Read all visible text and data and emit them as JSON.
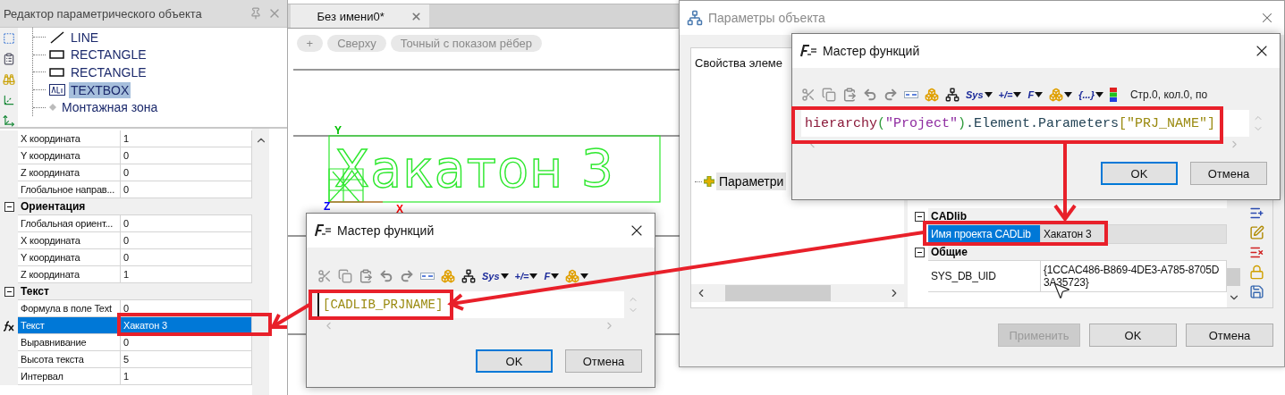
{
  "left_panel": {
    "title": "Редактор параметрического объекта",
    "tree": [
      {
        "label": "LINE",
        "kind": "line",
        "selected": false
      },
      {
        "label": "RECTANGLE",
        "kind": "rectangle",
        "selected": false
      },
      {
        "label": "RECTANGLE",
        "kind": "rectangle",
        "selected": false
      },
      {
        "label": "TEXTBOX",
        "kind": "textbox",
        "selected": true
      },
      {
        "label": "Монтажная зона",
        "kind": "zone",
        "selected": false
      }
    ],
    "properties": [
      {
        "kind": "row",
        "label": "X координата",
        "value": "1",
        "selected": false,
        "formula": false
      },
      {
        "kind": "row",
        "label": "Y координата",
        "value": "0",
        "selected": false,
        "formula": false
      },
      {
        "kind": "row",
        "label": "Z координата",
        "value": "0",
        "selected": false,
        "formula": false
      },
      {
        "kind": "row",
        "label": "Глобальное направ...",
        "value": "0",
        "selected": false,
        "formula": false
      },
      {
        "kind": "group",
        "label": "Ориентация",
        "expanded": true
      },
      {
        "kind": "row",
        "label": "Глобальная ориент...",
        "value": "0",
        "selected": false,
        "formula": false
      },
      {
        "kind": "row",
        "label": "X координата",
        "value": "0",
        "selected": false,
        "formula": false
      },
      {
        "kind": "row",
        "label": "Y координата",
        "value": "0",
        "selected": false,
        "formula": false
      },
      {
        "kind": "row",
        "label": "Z координата",
        "value": "1",
        "selected": false,
        "formula": false
      },
      {
        "kind": "group",
        "label": "Текст",
        "expanded": true
      },
      {
        "kind": "row",
        "label": "Формула в поле Text",
        "value": "0",
        "selected": false,
        "formula": false
      },
      {
        "kind": "row",
        "label": "Текст",
        "value": "Хакатон 3",
        "selected": true,
        "formula": true
      },
      {
        "kind": "row",
        "label": "Выравнивание",
        "value": "0",
        "selected": false,
        "formula": false
      },
      {
        "kind": "row",
        "label": "Высота текста",
        "value": "5",
        "selected": false,
        "formula": false
      },
      {
        "kind": "row",
        "label": "Интервал",
        "value": "1",
        "selected": false,
        "formula": false
      }
    ]
  },
  "document": {
    "tab": "Без имени0*",
    "view_buttons": [
      "+",
      "Сверху",
      "Точный с показом рёбер"
    ],
    "drawing_text": "Хакатон 3",
    "axis_labels": [
      {
        "label": "Y",
        "color": "#00c000"
      },
      {
        "label": "Z",
        "color": "#0000ff"
      },
      {
        "label": "X",
        "color": "#ff0000"
      }
    ]
  },
  "wizard_left": {
    "title": "Мастер функций",
    "toolbar": [
      {
        "kind": "cut"
      },
      {
        "kind": "copy"
      },
      {
        "kind": "paste"
      },
      {
        "kind": "undo"
      },
      {
        "kind": "redo"
      },
      {
        "kind": "field"
      },
      {
        "kind": "cubes",
        "dropdown": false
      },
      {
        "kind": "tree"
      },
      {
        "kind": "text",
        "label": "Sys",
        "dropdown": true
      },
      {
        "kind": "text",
        "label": "+/=",
        "dropdown": true
      },
      {
        "kind": "text",
        "label": "F",
        "dropdown": true
      },
      {
        "kind": "cubes",
        "dropdown": true
      }
    ],
    "formula": [
      {
        "text": "[CADLIB_PRJNAME]",
        "kind": "parameter"
      }
    ],
    "buttons": [
      {
        "label": "OK",
        "default": true
      },
      {
        "label": "Отмена",
        "default": false
      }
    ]
  },
  "object_parameters": {
    "title": "Параметры объекта",
    "tree_header": "Свойства элеме",
    "tree": [
      {
        "label": "Параметри",
        "selected": true
      }
    ],
    "properties": [
      {
        "kind": "group",
        "label": "CADlib",
        "expanded": true
      },
      {
        "kind": "row",
        "label": "Имя проекта CADLib",
        "value": "Хакатон 3",
        "selected": true
      },
      {
        "kind": "group",
        "label": "Общие",
        "expanded": true
      },
      {
        "kind": "row",
        "label": "SYS_DB_UID",
        "value": "{1CCAC486-B869-4DE3-A785-8705D3A35723}",
        "selected": false
      }
    ],
    "buttons": [
      {
        "label": "Применить",
        "disabled": true
      },
      {
        "label": "OK",
        "disabled": false
      },
      {
        "label": "Отмена",
        "disabled": false
      }
    ]
  },
  "wizard_right": {
    "title": "Мастер функций",
    "toolbar": [
      {
        "kind": "cut"
      },
      {
        "kind": "copy"
      },
      {
        "kind": "paste"
      },
      {
        "kind": "undo"
      },
      {
        "kind": "redo"
      },
      {
        "kind": "field"
      },
      {
        "kind": "cubes",
        "dropdown": false
      },
      {
        "kind": "tree"
      },
      {
        "kind": "text",
        "label": "Sys",
        "dropdown": true
      },
      {
        "kind": "text",
        "label": "+/=",
        "dropdown": true
      },
      {
        "kind": "text",
        "label": "F",
        "dropdown": true
      },
      {
        "kind": "cubes",
        "dropdown": true
      },
      {
        "kind": "text",
        "label": "{...}",
        "dropdown": true
      },
      {
        "kind": "colors"
      }
    ],
    "status": "Стр.0, кол.0, по",
    "formula": [
      {
        "text": "hierarchy",
        "kind": "function"
      },
      {
        "text": "(",
        "kind": "paren"
      },
      {
        "text": "\"Project\"",
        "kind": "string"
      },
      {
        "text": ")",
        "kind": "paren"
      },
      {
        "text": ".Element.Parameters",
        "kind": "member"
      },
      {
        "text": "[\"PRJ_NAME\"]",
        "kind": "parameter"
      }
    ],
    "buttons": [
      {
        "label": "OK",
        "default": true
      },
      {
        "label": "Отмена",
        "default": false
      }
    ]
  }
}
